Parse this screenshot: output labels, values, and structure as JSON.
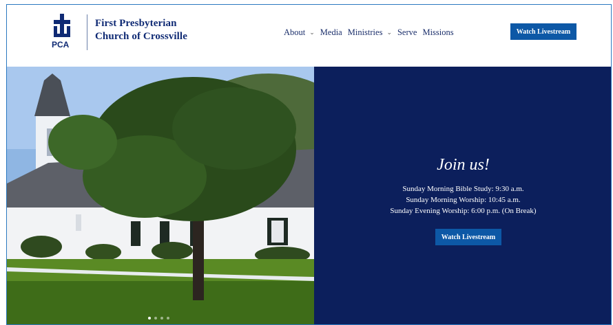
{
  "brand": {
    "line1": "First Presbyterian",
    "line2": "Church of Crossville",
    "mark_text": "PCA"
  },
  "nav": {
    "items": [
      {
        "label": "About",
        "has_dropdown": true
      },
      {
        "label": "Media",
        "has_dropdown": false
      },
      {
        "label": "Ministries",
        "has_dropdown": true
      },
      {
        "label": "Serve",
        "has_dropdown": false
      },
      {
        "label": "Missions",
        "has_dropdown": false
      }
    ],
    "cta": "Watch Livestream"
  },
  "hero": {
    "heading": "Join us!",
    "schedule": [
      "Sunday Morning Bible Study: 9:30 a.m.",
      "Sunday Morning Worship: 10:45 a.m.",
      "Sunday Evening Worship: 6:00 p.m. (On Break)"
    ],
    "cta": "Watch Livestream",
    "slides": 4,
    "active_slide": 1
  },
  "colors": {
    "navy": "#0c1f5c",
    "button": "#0d58a6",
    "brand_text": "#0f2a74"
  }
}
